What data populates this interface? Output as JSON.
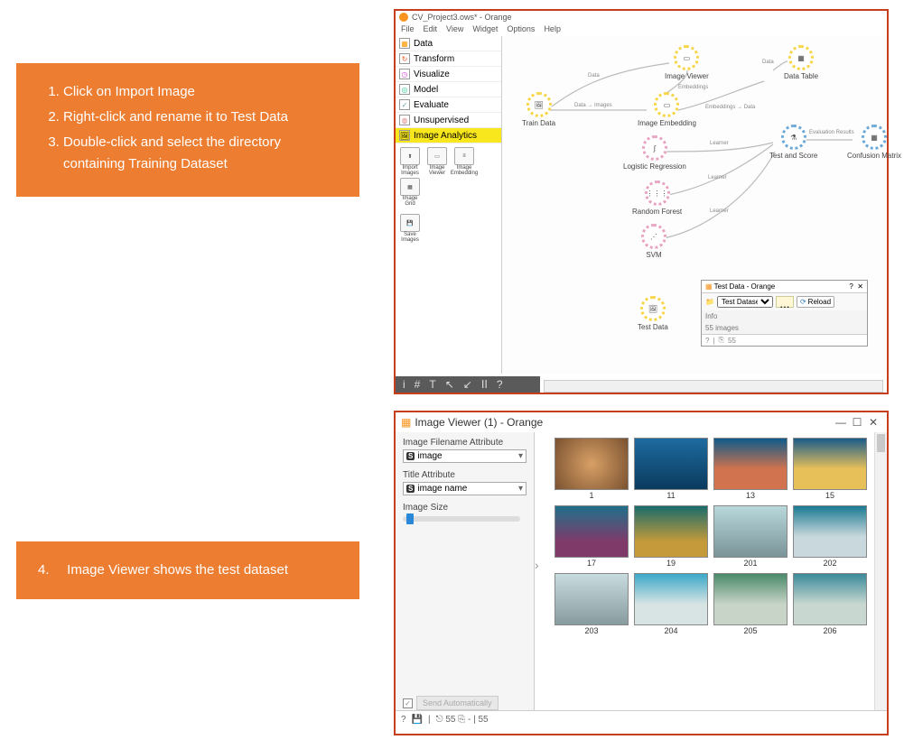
{
  "instructions1": {
    "items": [
      "Click on Import Image",
      "Right-click and rename it to Test Data",
      "Double-click and select the directory containing Training Dataset"
    ]
  },
  "instructions2": {
    "num": "4.",
    "text": "Image Viewer shows the test dataset"
  },
  "app": {
    "title": "CV_Project3.ows* - Orange",
    "menu": [
      "File",
      "Edit",
      "View",
      "Widget",
      "Options",
      "Help"
    ],
    "categories": [
      "Data",
      "Transform",
      "Visualize",
      "Model",
      "Evaluate",
      "Unsupervised",
      "Image Analytics"
    ],
    "widgets": [
      "Import Images",
      "Image Viewer",
      "Image Embedding",
      "Image Grid",
      "Save Images"
    ],
    "toolbar": [
      "i",
      "#",
      "T",
      "↖",
      "↙",
      "ⅠⅠ",
      "?"
    ]
  },
  "canvas": {
    "nodes": {
      "train": "Train Data",
      "viewer": "Image Viewer",
      "embedding": "Image Embedding",
      "datatable": "Data Table",
      "logreg": "Logistic Regression",
      "rf": "Random Forest",
      "svm": "SVM",
      "testscore": "Test and Score",
      "confmat": "Confusion Matrix",
      "testdata": "Test Data"
    },
    "edges": {
      "e1": "Data",
      "e2": "Data → Images",
      "e3": "Embeddings → Data",
      "e4": "Embeddings",
      "e5": "Data",
      "e6": "Learner",
      "e7": "Learner",
      "e8": "Learner",
      "e9": "Evaluation Results"
    }
  },
  "dialog": {
    "title": "Test Data - Orange",
    "dataset": "Test Dataset",
    "browse": "...",
    "reload": "Reload",
    "info": "Info",
    "count": "55 images",
    "status": "55"
  },
  "viewer": {
    "title": "Image Viewer (1) - Orange",
    "labels": {
      "filename": "Image Filename Attribute",
      "titleattr": "Title Attribute",
      "size": "Image Size"
    },
    "sel1": "image",
    "sel2": "image name",
    "send": "Send Automatically",
    "status": "⎋ 55  ⎘ - | 55"
  },
  "thumbs": [
    "1",
    "11",
    "13",
    "15",
    "17",
    "19",
    "201",
    "202",
    "203",
    "204",
    "205",
    "206"
  ]
}
